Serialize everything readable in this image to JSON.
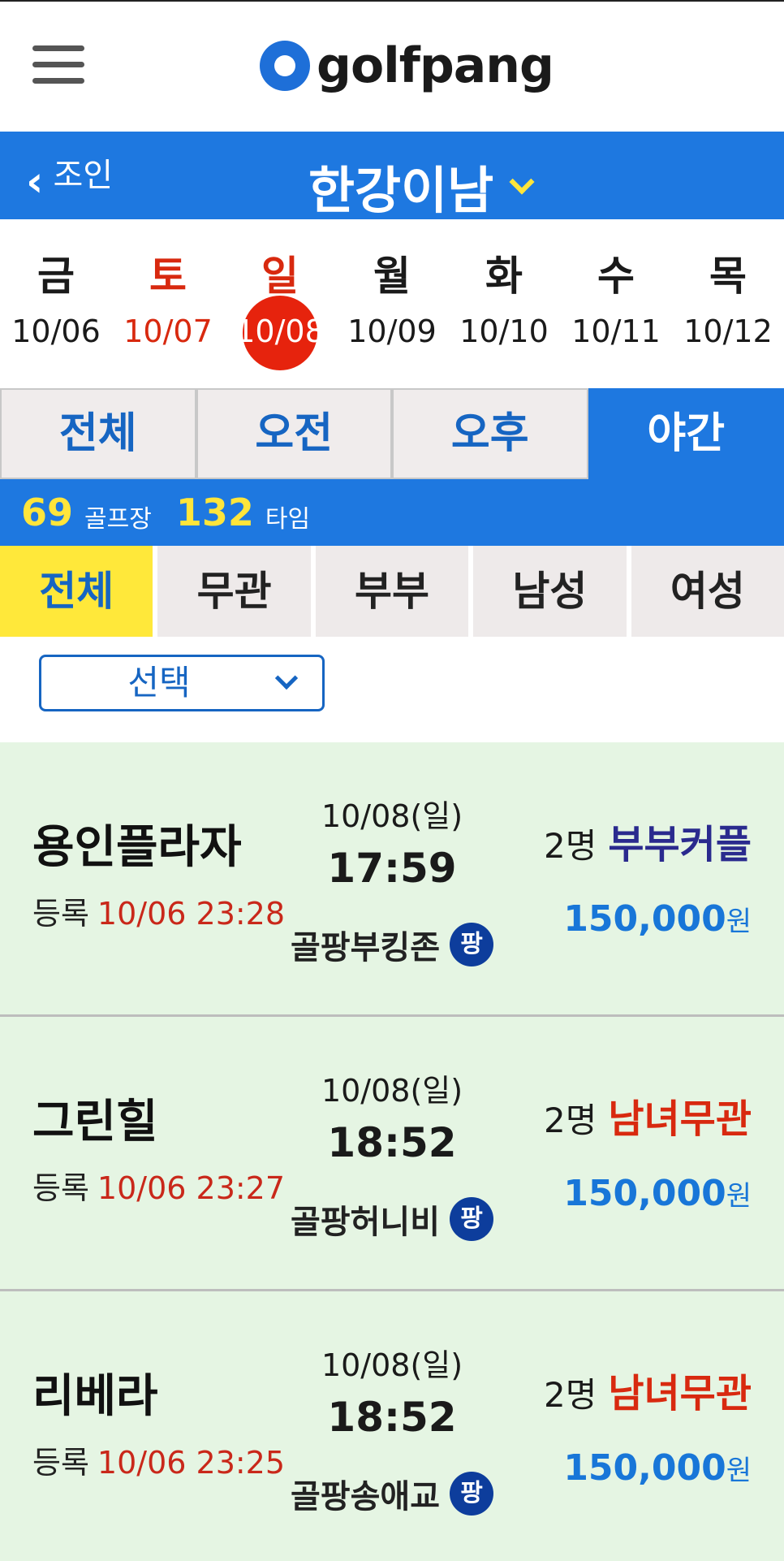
{
  "header": {
    "logo_text": "golfpang"
  },
  "titlebar": {
    "back_label": "조인",
    "region": "한강이남"
  },
  "dates": [
    {
      "day": "금",
      "date": "10/06",
      "kind": "weekday"
    },
    {
      "day": "토",
      "date": "10/07",
      "kind": "sat"
    },
    {
      "day": "일",
      "date": "10/08",
      "kind": "sun",
      "selected": true
    },
    {
      "day": "월",
      "date": "10/09",
      "kind": "weekday"
    },
    {
      "day": "화",
      "date": "10/10",
      "kind": "weekday"
    },
    {
      "day": "수",
      "date": "10/11",
      "kind": "weekday"
    },
    {
      "day": "목",
      "date": "10/12",
      "kind": "weekday"
    }
  ],
  "time_tabs": [
    "전체",
    "오전",
    "오후",
    "야간"
  ],
  "time_tab_active": 3,
  "counts": {
    "courses": "69",
    "courses_label": "골프장",
    "times": "132",
    "times_label": "타임"
  },
  "type_tabs": [
    "전체",
    "무관",
    "부부",
    "남성",
    "여성"
  ],
  "type_tab_active": 0,
  "select": {
    "value": "선택"
  },
  "listings": [
    {
      "course": "용인플라자",
      "reg_label": "등록",
      "reg_time": "10/06 23:28",
      "date": "10/08(일)",
      "time": "17:59",
      "host": "골팡부킹존",
      "badge": "팡",
      "people": "2명",
      "type": "부부커플",
      "type_kind": "couple",
      "price": "150,000",
      "unit": "원"
    },
    {
      "course": "그린힐",
      "reg_label": "등록",
      "reg_time": "10/06 23:27",
      "date": "10/08(일)",
      "time": "18:52",
      "host": "골팡허니비",
      "badge": "팡",
      "people": "2명",
      "type": "남녀무관",
      "type_kind": "mixed",
      "price": "150,000",
      "unit": "원"
    },
    {
      "course": "리베라",
      "reg_label": "등록",
      "reg_time": "10/06 23:25",
      "date": "10/08(일)",
      "time": "18:52",
      "host": "골팡송애교",
      "badge": "팡",
      "people": "2명",
      "type": "남녀무관",
      "type_kind": "mixed",
      "price": "150,000",
      "unit": "원"
    }
  ],
  "colors": {
    "brand_blue": "#1e78e0",
    "accent_yellow": "#ffe53b",
    "weekend_red": "#d8290f",
    "list_bg": "#e5f5e3"
  }
}
